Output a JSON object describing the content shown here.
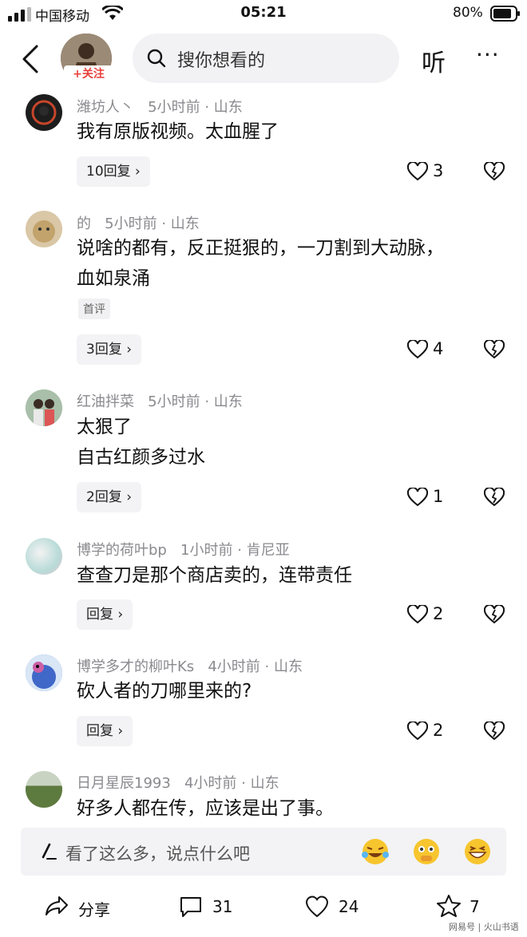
{
  "status": {
    "carrier": "中国移动",
    "time": "05:21",
    "battery": "80%"
  },
  "header": {
    "follow": "+关注",
    "search_placeholder": "搜你想看的",
    "listen": "听",
    "more": "···"
  },
  "comments": [
    {
      "user": "潍坊人丶",
      "time": "5小时前",
      "loc": "山东",
      "lines": [
        "我有原版视频。太血腥了"
      ],
      "tag": "",
      "reply": "10回复",
      "likes": "3"
    },
    {
      "user": "的",
      "time": "5小时前",
      "loc": "山东",
      "lines": [
        "说啥的都有，反正挺狠的，一刀割到大动脉，",
        "血如泉涌"
      ],
      "tag": "首评",
      "reply": "3回复",
      "likes": "4"
    },
    {
      "user": "红油拌菜",
      "time": "5小时前",
      "loc": "山东",
      "lines": [
        "太狠了",
        "自古红颜多过水"
      ],
      "tag": "",
      "reply": "2回复",
      "likes": "1"
    },
    {
      "user": "博学的荷叶bp",
      "time": "1小时前",
      "loc": "肯尼亚",
      "lines": [
        "查查刀是那个商店卖的，连带责任"
      ],
      "tag": "",
      "reply": "回复",
      "likes": "2"
    },
    {
      "user": "博学多才的柳叶Ks",
      "time": "4小时前",
      "loc": "山东",
      "lines": [
        "砍人者的刀哪里来的?"
      ],
      "tag": "",
      "reply": "回复",
      "likes": "2"
    },
    {
      "user": "日月星辰1993",
      "time": "4小时前",
      "loc": "山东",
      "lines": [
        "好多人都在传，应该是出了事。"
      ],
      "tag": "",
      "reply": "",
      "likes": ""
    }
  ],
  "input": {
    "placeholder": "看了这么多，说点什么吧"
  },
  "bottom": {
    "share": "分享",
    "comments": "31",
    "likes": "24",
    "favorites": "7"
  },
  "watermark": "网易号 | 火山书语"
}
